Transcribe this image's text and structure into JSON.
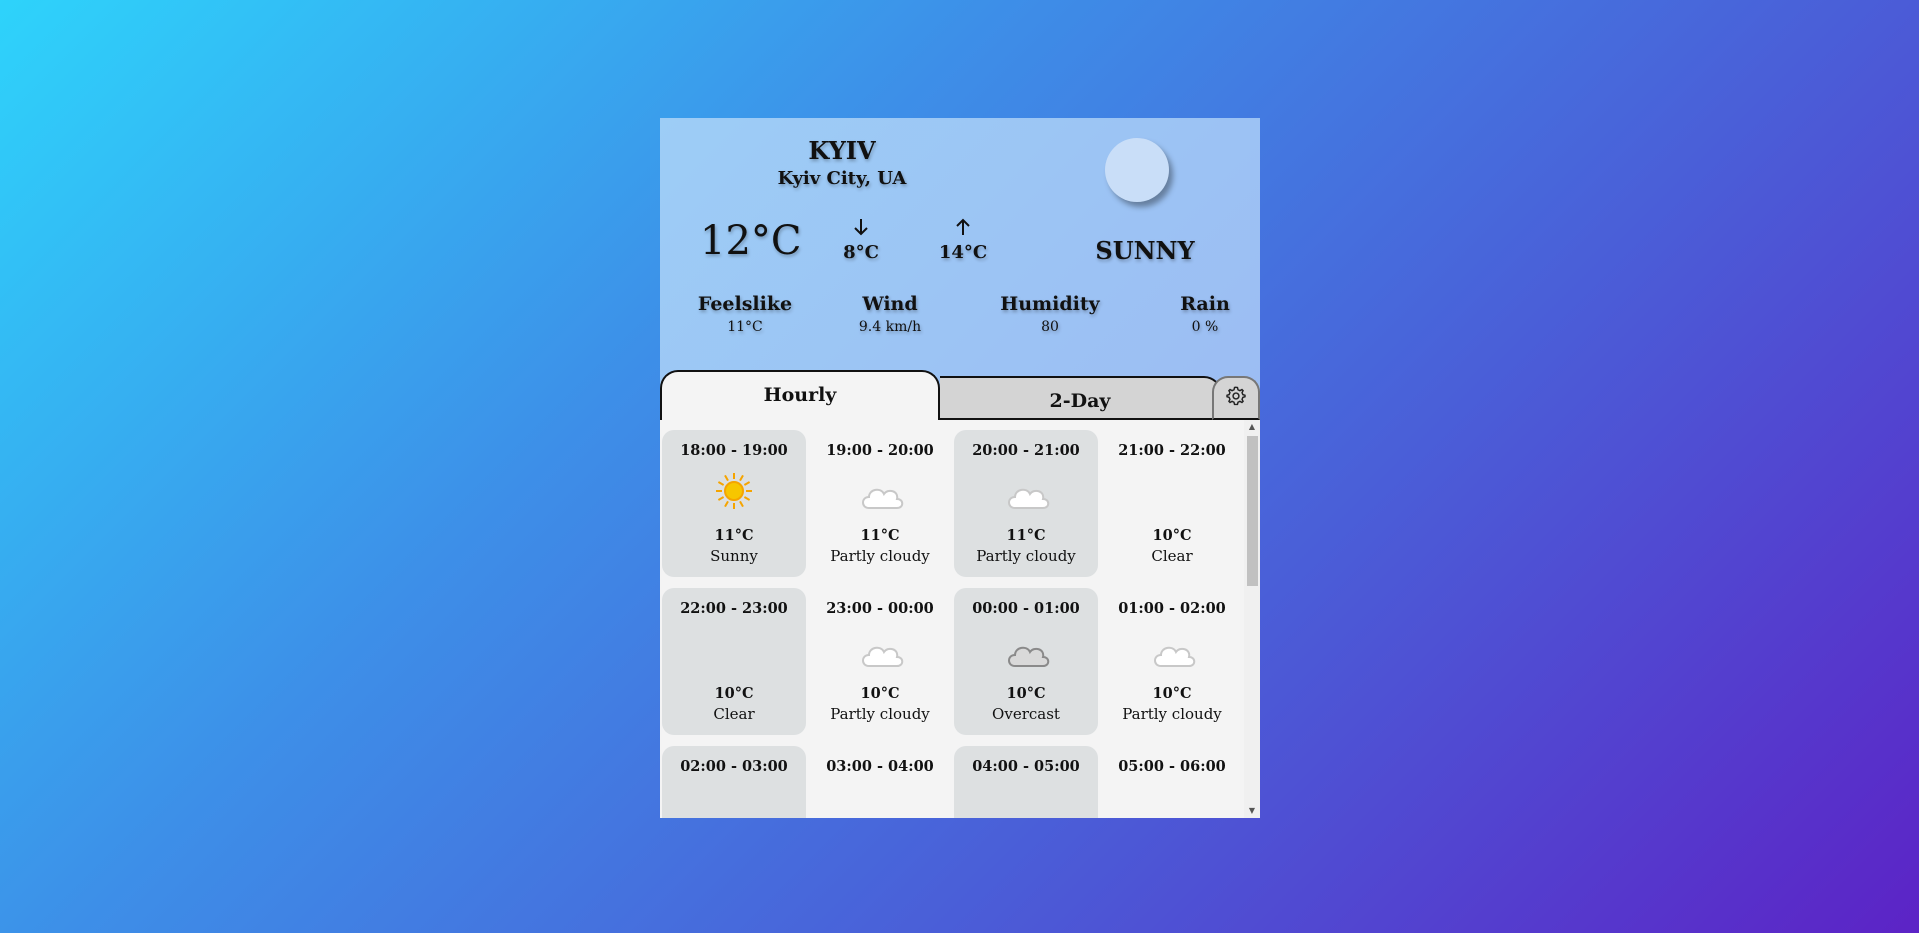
{
  "location": {
    "city": "KYIV",
    "region": "Kyiv City, UA"
  },
  "current": {
    "temp": "12°C",
    "min": "8°C",
    "max": "14°C",
    "condition": "SUNNY",
    "mode_icon": "moon-icon"
  },
  "stats": [
    {
      "label": "Feelslike",
      "value": "11°C"
    },
    {
      "label": "Wind",
      "value": "9.4 km/h"
    },
    {
      "label": "Humidity",
      "value": "80"
    },
    {
      "label": "Rain",
      "value": "0 %"
    }
  ],
  "tabs": {
    "hourly": "Hourly",
    "two_day": "2-Day",
    "settings_icon": "gear-icon"
  },
  "hourly": [
    {
      "time": "18:00 - 19:00",
      "temp": "11°C",
      "desc": "Sunny",
      "icon": "sun-icon"
    },
    {
      "time": "19:00 - 20:00",
      "temp": "11°C",
      "desc": "Partly cloudy",
      "icon": "partly-cloudy-night-icon"
    },
    {
      "time": "20:00 - 21:00",
      "temp": "11°C",
      "desc": "Partly cloudy",
      "icon": "partly-cloudy-night-icon"
    },
    {
      "time": "21:00 - 22:00",
      "temp": "10°C",
      "desc": "Clear",
      "icon": "moon-icon"
    },
    {
      "time": "22:00 - 23:00",
      "temp": "10°C",
      "desc": "Clear",
      "icon": "moon-icon"
    },
    {
      "time": "23:00 - 00:00",
      "temp": "10°C",
      "desc": "Partly cloudy",
      "icon": "partly-cloudy-night-icon"
    },
    {
      "time": "00:00 - 01:00",
      "temp": "10°C",
      "desc": "Overcast",
      "icon": "overcast-cloud-icon"
    },
    {
      "time": "01:00 - 02:00",
      "temp": "10°C",
      "desc": "Partly cloudy",
      "icon": "partly-cloudy-night-icon"
    },
    {
      "time": "02:00 - 03:00",
      "temp": "",
      "desc": "",
      "icon": "moon-icon"
    },
    {
      "time": "03:00 - 04:00",
      "temp": "",
      "desc": "",
      "icon": "moon-icon"
    },
    {
      "time": "04:00 - 05:00",
      "temp": "",
      "desc": "",
      "icon": "moon-icon"
    },
    {
      "time": "05:00 - 06:00",
      "temp": "",
      "desc": "",
      "icon": "moon-icon"
    }
  ],
  "colors": {
    "moon": "#1a73c8",
    "sun": "#f7c600",
    "cloud": "#ffffff",
    "overcast": "#d9d9d9"
  }
}
